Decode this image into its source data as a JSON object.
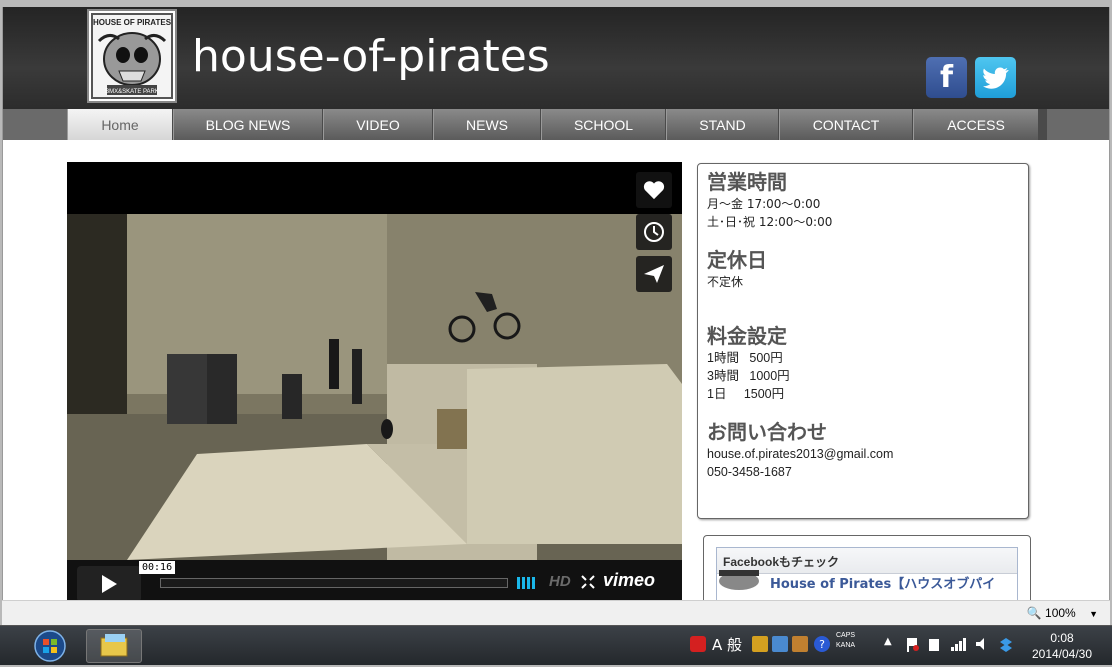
{
  "site": {
    "title": "house-of-pirates",
    "logo_text_top": "HOUSE OF PIRATES",
    "logo_text_bottom": "BMX&SKATE PARK"
  },
  "social": {
    "facebook_glyph": "f",
    "twitter_icon": "twitter-bird-icon"
  },
  "nav": [
    {
      "label": "Home",
      "active": true
    },
    {
      "label": "BLOG NEWS"
    },
    {
      "label": "VIDEO"
    },
    {
      "label": "NEWS"
    },
    {
      "label": "SCHOOL"
    },
    {
      "label": "STAND"
    },
    {
      "label": "CONTACT"
    },
    {
      "label": "ACCESS"
    }
  ],
  "video": {
    "time": "00:16",
    "hd_label": "HD",
    "brand": "vimeo",
    "side_buttons": [
      "heart-icon",
      "clock-icon",
      "send-icon"
    ]
  },
  "info": {
    "hours_title": "営業時間",
    "hours_weekday": "月～金  17:00～0:00",
    "hours_weekend": "土･日･祝  12:00～0:00",
    "closed_title": "定休日",
    "closed_text": "不定休",
    "price_title": "料金設定",
    "price_1": "1時間   500円",
    "price_2": "3時間   1000円",
    "price_3": "1日     1500円",
    "contact_title": "お問い合わせ",
    "email": "house.of.pirates2013@gmail.com",
    "phone": "050-3458-1687"
  },
  "facebook_widget": {
    "header": "Facebookもチェック",
    "page_name": "House of Pirates【ハウスオブパイ"
  },
  "browser": {
    "zoom": "100%"
  },
  "taskbar": {
    "time": "0:08",
    "date": "2014/04/30",
    "ime": "A 般",
    "caps": "CAPS",
    "kana": "KANA"
  }
}
